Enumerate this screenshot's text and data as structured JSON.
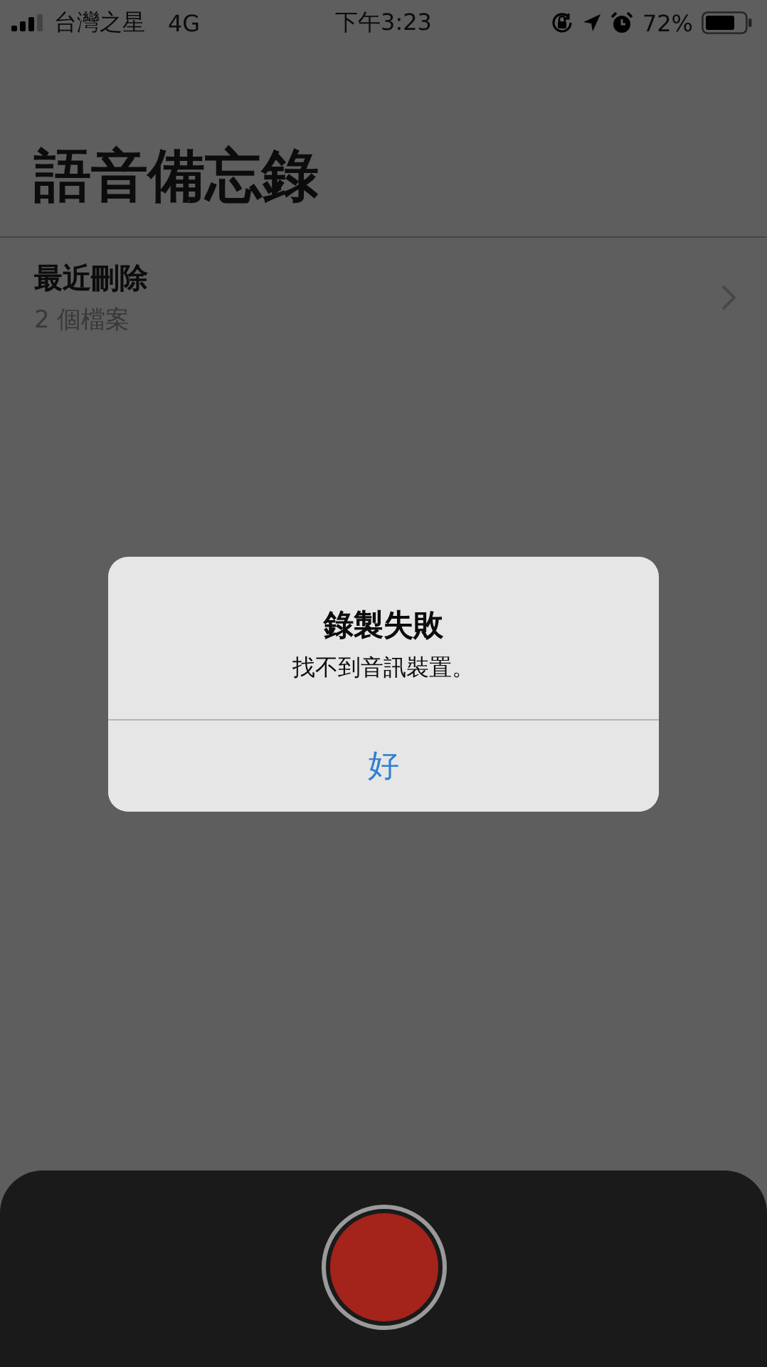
{
  "status_bar": {
    "carrier": "台灣之星",
    "network": "4G",
    "time": "下午3:23",
    "battery": "72%"
  },
  "title": "語音備忘錄",
  "folders": [
    {
      "name": "最近刪除",
      "count": "2 個檔案"
    }
  ],
  "alert": {
    "title": "錄製失敗",
    "message": "找不到音訊裝置。",
    "buttons": [
      "好"
    ]
  }
}
